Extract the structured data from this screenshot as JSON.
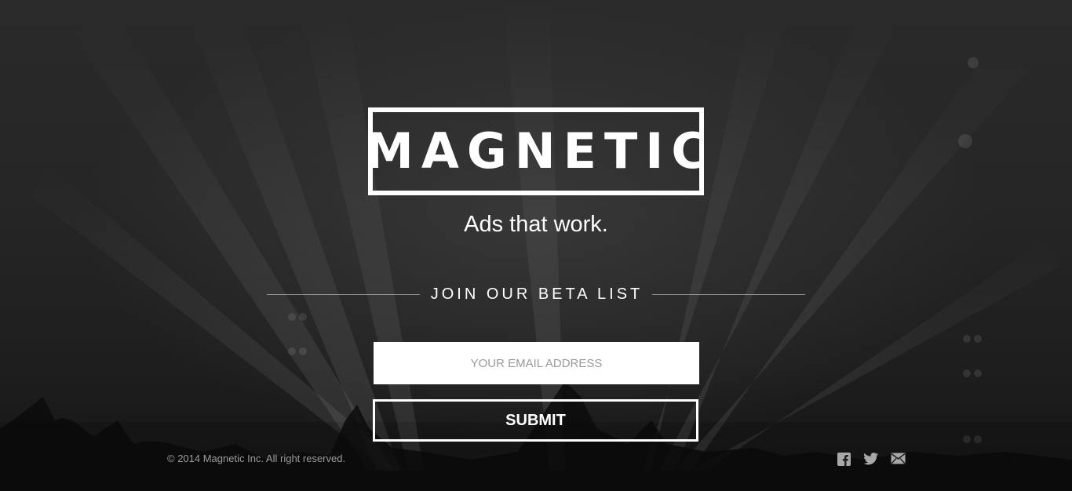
{
  "hero": {
    "logo_text": "MAGNETIC",
    "tagline": "Ads that work."
  },
  "signup": {
    "heading": "JOIN OUR BETA LIST",
    "email_placeholder": "YOUR EMAIL ADDRESS",
    "email_value": "",
    "submit_label": "SUBMIT"
  },
  "footer": {
    "copyright": "© 2014 Magnetic Inc. All right reserved.",
    "social_icons": [
      "facebook-icon",
      "twitter-icon",
      "email-icon"
    ]
  },
  "colors": {
    "text": "#ffffff",
    "footer_text": "#9c9c9c",
    "icon": "#a8a8a8",
    "input_bg": "#ffffff"
  }
}
